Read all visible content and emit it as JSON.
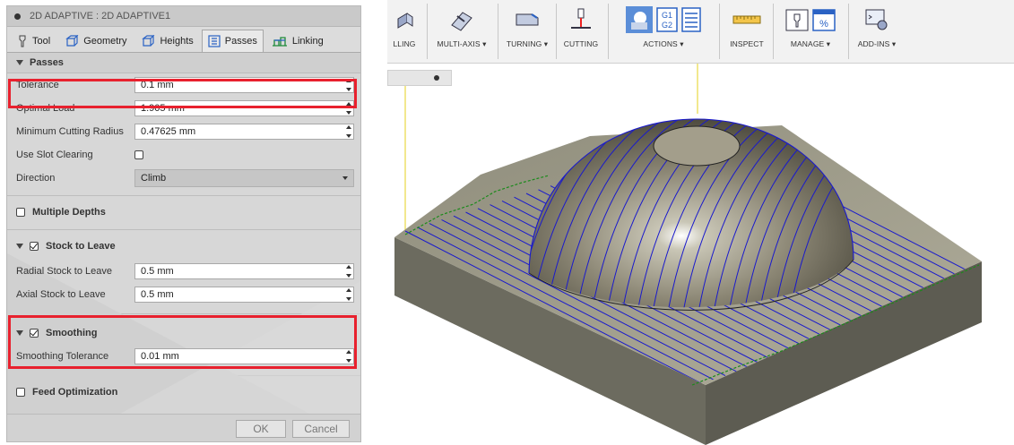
{
  "dialog": {
    "title": "2D ADAPTIVE : 2D ADAPTIVE1",
    "tabs": [
      {
        "label": "Tool",
        "icon": "tool-icon"
      },
      {
        "label": "Geometry",
        "icon": "geometry-icon"
      },
      {
        "label": "Heights",
        "icon": "heights-icon"
      },
      {
        "label": "Passes",
        "icon": "passes-icon",
        "active": true
      },
      {
        "label": "Linking",
        "icon": "linking-icon"
      }
    ],
    "passes": {
      "section": "Passes",
      "tolerance": {
        "label": "Tolerance",
        "value": "0.1 mm"
      },
      "optimal_load": {
        "label": "Optimal Load",
        "value": "1.905 mm"
      },
      "min_radius": {
        "label": "Minimum Cutting Radius",
        "value": "0.47625 mm"
      },
      "slot": {
        "label": "Use Slot Clearing",
        "checked": false
      },
      "direction": {
        "label": "Direction",
        "value": "Climb"
      }
    },
    "multiple_depths": {
      "label": "Multiple Depths",
      "checked": false
    },
    "stock": {
      "label": "Stock to Leave",
      "checked": true,
      "radial": {
        "label": "Radial Stock to Leave",
        "value": "0.5 mm"
      },
      "axial": {
        "label": "Axial Stock to Leave",
        "value": "0.5 mm"
      }
    },
    "smoothing": {
      "label": "Smoothing",
      "checked": true,
      "tolerance": {
        "label": "Smoothing Tolerance",
        "value": "0.01 mm"
      }
    },
    "feed": {
      "label": "Feed Optimization",
      "checked": false
    },
    "ok": "OK",
    "cancel": "Cancel"
  },
  "toolbar": {
    "groups": [
      {
        "label": "LLING",
        "icon": "milling-icon"
      },
      {
        "label": "MULTI-AXIS ▾",
        "icon": "multi-axis-icon"
      },
      {
        "label": "TURNING ▾",
        "icon": "turning-icon"
      },
      {
        "label": "CUTTING",
        "icon": "cutting-icon"
      },
      {
        "label": "ACTIONS ▾",
        "icon": "actions-icon"
      },
      {
        "label": "INSPECT",
        "icon": "inspect-icon"
      },
      {
        "label": "MANAGE ▾",
        "icon": "manage-icon"
      },
      {
        "label": "ADD-INS ▾",
        "icon": "add-ins-icon"
      }
    ],
    "actions_g_code": {
      "line1": "G1",
      "line2": "G2"
    },
    "manage_percent": "%"
  },
  "colors": {
    "highlight": "#e8212e",
    "toolpath": "#1a1acc",
    "stock_top": "#8e8b78",
    "stock_side": "#6e6d62",
    "dome": "#a19c88"
  }
}
